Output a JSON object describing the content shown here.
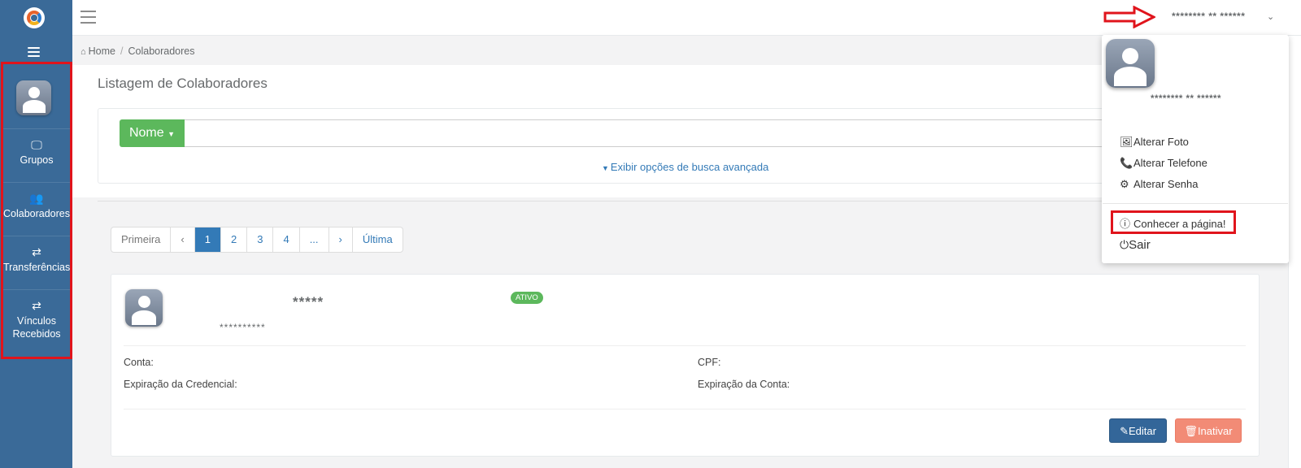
{
  "sidebar": {
    "items": [
      {
        "label": "Grupos",
        "icon": "desktop-icon"
      },
      {
        "label": "Colaboradores",
        "icon": "users-icon"
      },
      {
        "label": "Transferências",
        "icon": "transfer-icon"
      },
      {
        "label": "Vínculos Recebidos",
        "icon": "transfer-icon"
      }
    ]
  },
  "header": {
    "user_name": "******** ** ******"
  },
  "breadcrumb": {
    "home": "Home",
    "current": "Colaboradores"
  },
  "page": {
    "title": "Listagem de Colaboradores"
  },
  "search": {
    "filter_label": "Nome",
    "placeholder": "",
    "advanced_link": "Exibir opções de busca avançada"
  },
  "pagination": {
    "first": "Primeira",
    "prev": "‹",
    "pages": [
      "1",
      "2",
      "3",
      "4",
      "..."
    ],
    "next": "›",
    "last": "Última",
    "active_page": "1"
  },
  "card": {
    "name": "*****",
    "subtitle": "**********",
    "status": "ATIVO",
    "fields": {
      "conta": "Conta:",
      "cpf": "CPF:",
      "expiracao_credencial": "Expiração da Credencial:",
      "expiracao_conta": "Expiração da Conta:"
    },
    "edit_label": "Editar",
    "inactivate_label": "Inativar"
  },
  "dropdown": {
    "user_name": "******** ** ******",
    "alterar_foto": "Alterar Foto",
    "alterar_telefone": "Alterar Telefone",
    "alterar_senha": "Alterar Senha",
    "conhecer": "Conhecer a página!",
    "sair": "Sair"
  },
  "colors": {
    "sidebar": "#3a6a98",
    "primary": "#337ab7",
    "success": "#5cb85c",
    "danger_light": "#f28b76",
    "annotation": "#e0141c"
  }
}
